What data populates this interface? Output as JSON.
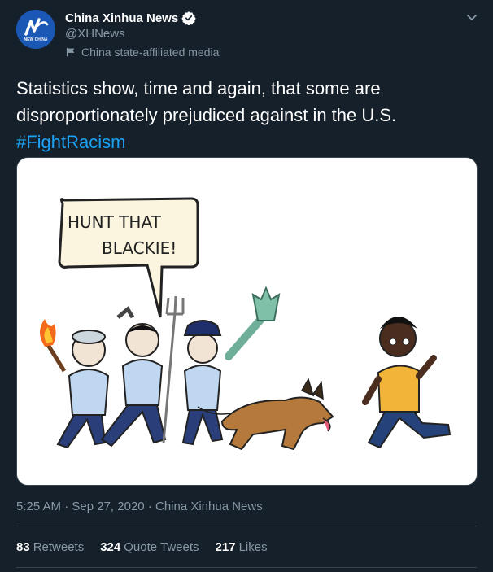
{
  "account": {
    "display_name": "China Xinhua News",
    "handle": "@XHNews",
    "verified": true,
    "affiliation_label": "China state-affiliated media",
    "avatar_text": "NEW CHINA"
  },
  "tweet": {
    "text_line1": "Statistics show, time and again, that some are",
    "text_line2": "disproportionately prejudiced against in the U.S.",
    "hashtag": "#FightRacism",
    "image": {
      "bubble_line1": "HUNT THAT",
      "bubble_line2": "BLACKIE!"
    },
    "time": "5:25 AM",
    "date": "Sep 27, 2020",
    "source": "China Xinhua News"
  },
  "stats": {
    "retweets_count": "83",
    "retweets_label": "Retweets",
    "quotes_count": "324",
    "quotes_label": "Quote Tweets",
    "likes_count": "217",
    "likes_label": "Likes"
  },
  "colors": {
    "background": "#15202b",
    "accent": "#1da1f2",
    "secondary_text": "#8899a6",
    "divider": "#38444d"
  }
}
